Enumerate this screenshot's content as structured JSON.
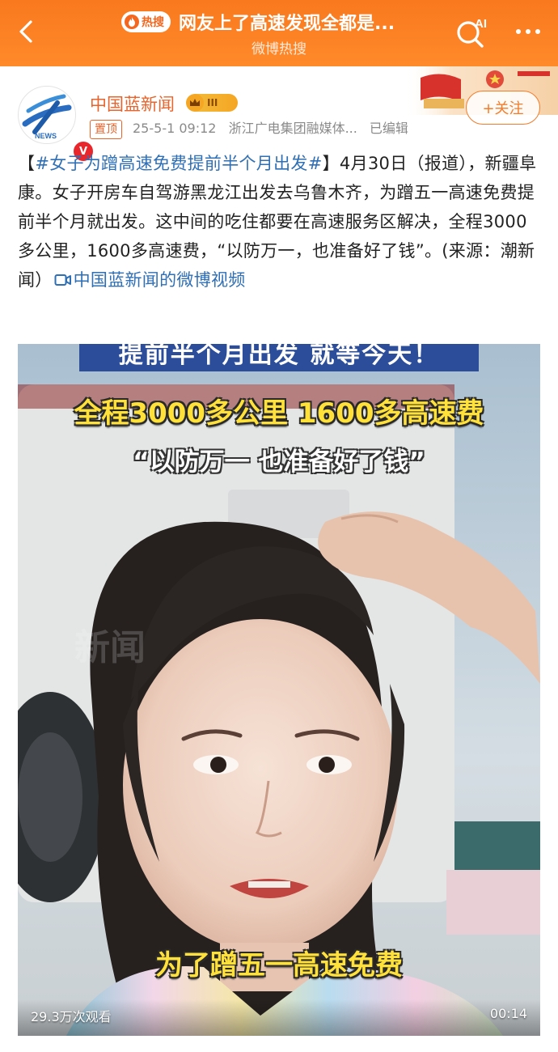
{
  "header": {
    "hot_badge": "热搜",
    "title": "网友上了高速发现全都是...",
    "subtitle": "微博热搜",
    "ai_label": "AI",
    "bg_color": "#f97a1f"
  },
  "post": {
    "author": "中国蓝新闻",
    "level": "III",
    "pinned": "置顶",
    "timestamp": "25-5-1 09:12",
    "source": "浙江广电集团融媒体...",
    "edited": "已编辑",
    "follow_label": "+关注",
    "verified_badge": "V",
    "text_bracket_open": "【",
    "hashtag": "#女子为蹭高速免费提前半个月出发#",
    "text_body": "】4月30日（报道），新疆阜康。女子开房车自驾游黑龙江出发去乌鲁木齐，为蹭五一高速免费提前半个月就出发。这中间的吃住都要在高速服务区解决，全程3000多公里，1600多高速费，“以防万一，也准备好了钱”。(来源：潮新闻）",
    "video_link": "中国蓝新闻的微博视频",
    "accent_color": "#e8642c",
    "link_color": "#2f6fb5"
  },
  "video": {
    "caption_top": "提前半个月出发 就等今天！",
    "caption_line2": "全程3000多公里 1600多高速费",
    "caption_line3": "“以防万一 也准备好了钱”",
    "caption_bottom": "为了蹭五一高速免费",
    "watermark": "新闻",
    "views": "29.3万次观看",
    "duration": "00:14"
  },
  "icons": [
    "back-chevron-icon",
    "flame-icon",
    "ai-search-icon",
    "more-dots-icon",
    "crown-icon",
    "video-link-icon"
  ]
}
